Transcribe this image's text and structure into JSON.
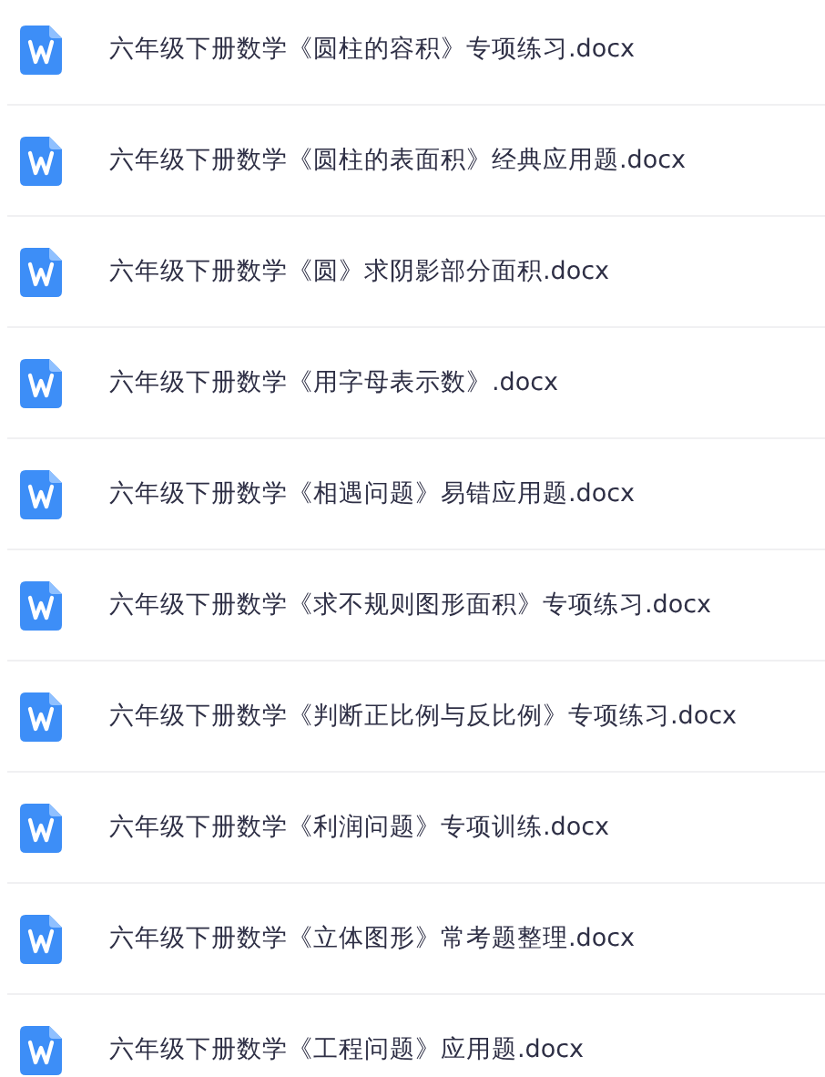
{
  "files": [
    {
      "name": "六年级下册数学《圆柱的容积》专项练习.docx"
    },
    {
      "name": "六年级下册数学《圆柱的表面积》经典应用题.docx"
    },
    {
      "name": "六年级下册数学《圆》求阴影部分面积.docx"
    },
    {
      "name": "六年级下册数学《用字母表示数》.docx"
    },
    {
      "name": "六年级下册数学《相遇问题》易错应用题.docx"
    },
    {
      "name": "六年级下册数学《求不规则图形面积》专项练习.docx"
    },
    {
      "name": "六年级下册数学《判断正比例与反比例》专项练习.docx"
    },
    {
      "name": "六年级下册数学《利润问题》专项训练.docx"
    },
    {
      "name": "六年级下册数学《立体图形》常考题整理.docx"
    },
    {
      "name": "六年级下册数学《工程问题》应用题.docx"
    }
  ]
}
